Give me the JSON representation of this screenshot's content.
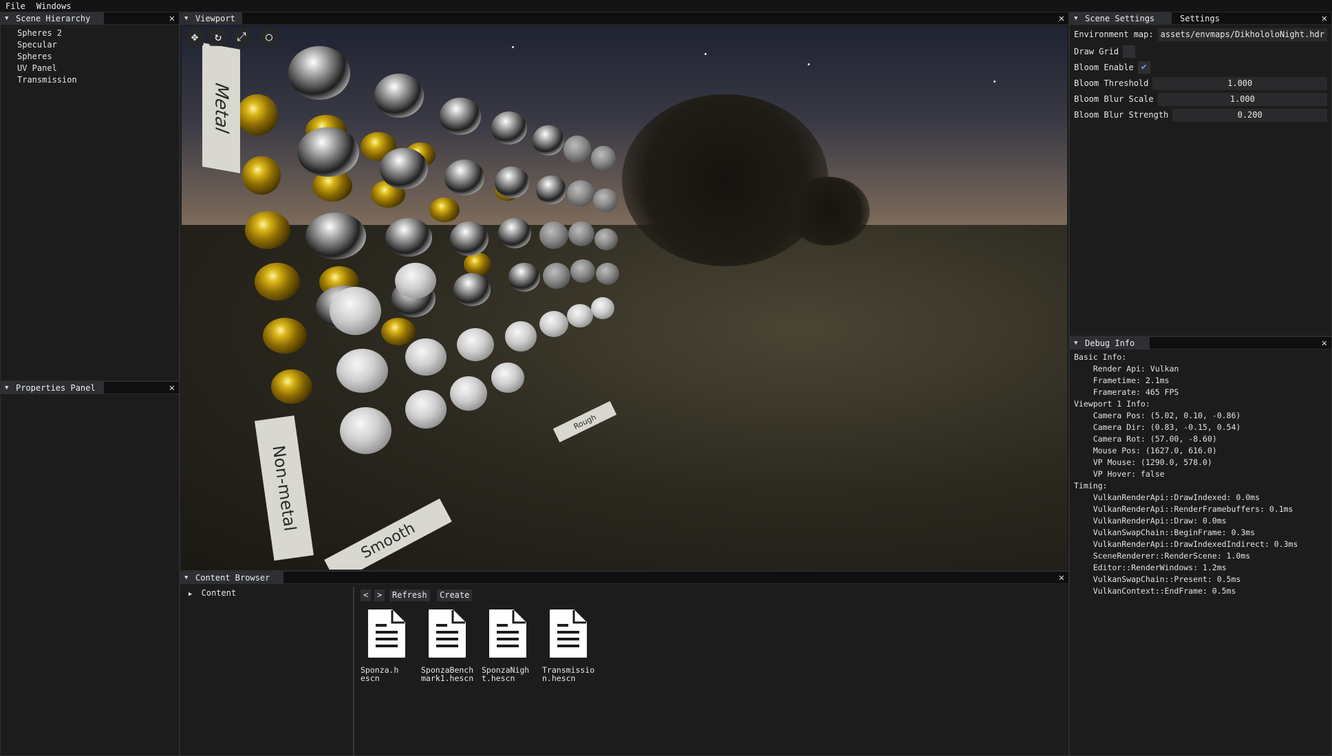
{
  "menu": {
    "items": [
      "File",
      "Windows"
    ]
  },
  "scene_hierarchy": {
    "title": "Scene Hierarchy",
    "items": [
      "Spheres 2",
      "Specular",
      "Spheres",
      "UV Panel",
      "Transmission"
    ]
  },
  "properties_panel": {
    "title": "Properties Panel"
  },
  "viewport": {
    "title": "Viewport",
    "tools": [
      "move-tool-icon",
      "rotate-tool-icon",
      "scale-tool-icon",
      "circle-tool-icon"
    ],
    "signs": {
      "metal": "Metal",
      "non_metal": "Non-metal",
      "smooth": "Smooth",
      "rough": "Rough"
    }
  },
  "scene_settings": {
    "tabs": [
      "Scene Settings",
      "Settings"
    ],
    "environment_map_label": "Environment map:",
    "environment_map_value": "assets/envmaps/DikhololoNight.hdr",
    "draw_grid_label": "Draw Grid",
    "draw_grid_checked": false,
    "bloom_enable_label": "Bloom Enable",
    "bloom_enable_checked": true,
    "bloom_threshold_label": "Bloom Threshold",
    "bloom_threshold_value": "1.000",
    "bloom_blur_scale_label": "Bloom Blur Scale",
    "bloom_blur_scale_value": "1.000",
    "bloom_blur_strength_label": "Bloom Blur Strength",
    "bloom_blur_strength_value": "0.200"
  },
  "debug_info": {
    "title": "Debug Info",
    "lines": [
      "Basic Info:",
      "    Render Api: Vulkan",
      "    Frametime: 2.1ms",
      "    Framerate: 465 FPS",
      "Viewport 1 Info:",
      "    Camera Pos: (5.02, 0.10, -0.86)",
      "    Camera Dir: (0.83, -0.15, 0.54)",
      "    Camera Rot: (57.00, -8.60)",
      "    Mouse Pos: (1627.0, 616.0)",
      "    VP Mouse: (1290.0, 578.0)",
      "    VP Hover: false",
      "Timing:",
      "    VulkanRenderApi::DrawIndexed: 0.0ms",
      "    VulkanRenderApi::RenderFramebuffers: 0.1ms",
      "    VulkanRenderApi::Draw: 0.0ms",
      "    VulkanSwapChain::BeginFrame: 0.3ms",
      "    VulkanRenderApi::DrawIndexedIndirect: 0.3ms",
      "    SceneRenderer::RenderScene: 1.0ms",
      "    Editor::RenderWindows: 1.2ms",
      "    VulkanSwapChain::Present: 0.5ms",
      "    VulkanContext::EndFrame: 0.5ms"
    ]
  },
  "content_browser": {
    "title": "Content Browser",
    "tree_root": "Content",
    "back_label": "<",
    "forward_label": ">",
    "refresh_label": "Refresh",
    "create_label": "Create",
    "files": [
      "Sponza.hescn",
      "SponzaBenchmark1.hescn",
      "SponzaNight.hescn",
      "Transmission.hescn"
    ]
  },
  "colors": {
    "accent": "#6aa1ff",
    "tab_bg": "#2d2f33",
    "panel_bg": "#1c1c1c"
  }
}
